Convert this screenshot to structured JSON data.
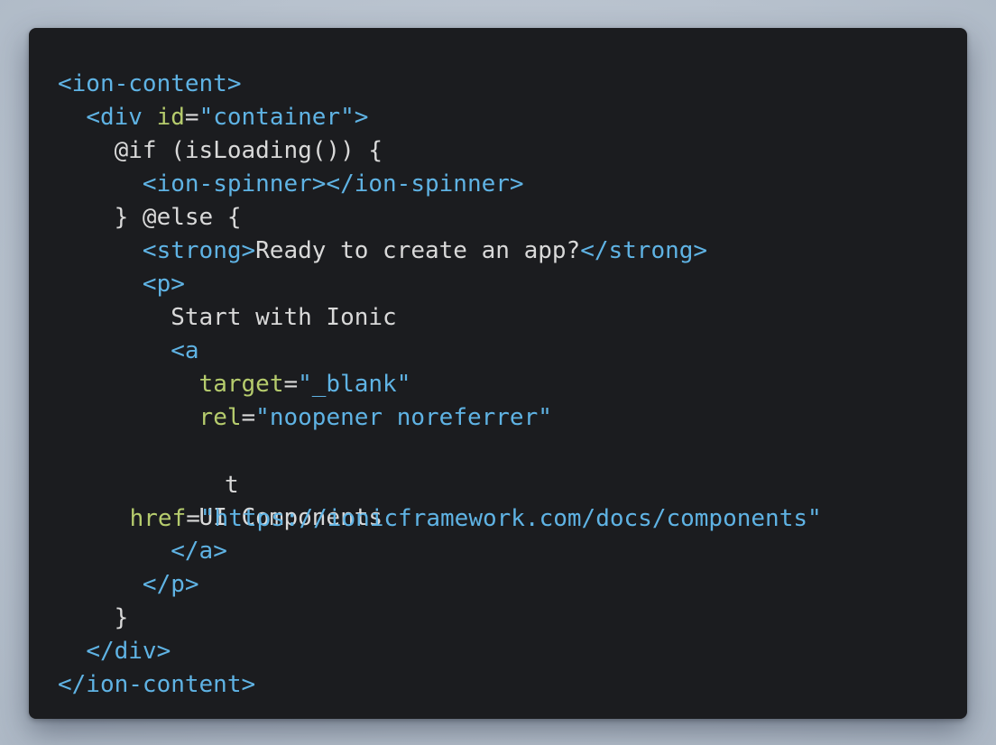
{
  "colors": {
    "background": "#b9c3cf",
    "editor_background": "#1b1c1f",
    "tag": "#5fb3e4",
    "attribute": "#b6cc6d",
    "string": "#5fb3e4",
    "text": "#d9d9d9"
  },
  "code": {
    "lines": [
      [
        {
          "t": "tag",
          "v": "<ion-content>"
        }
      ],
      [
        {
          "t": "text",
          "v": "  "
        },
        {
          "t": "tag",
          "v": "<div "
        },
        {
          "t": "attr",
          "v": "id"
        },
        {
          "t": "text",
          "v": "="
        },
        {
          "t": "str",
          "v": "\"container\""
        },
        {
          "t": "tag",
          "v": ">"
        }
      ],
      [
        {
          "t": "text",
          "v": "    @if (isLoading()) {"
        }
      ],
      [
        {
          "t": "text",
          "v": "      "
        },
        {
          "t": "tag",
          "v": "<ion-spinner></ion-spinner>"
        }
      ],
      [
        {
          "t": "text",
          "v": "    } @else {"
        }
      ],
      [
        {
          "t": "text",
          "v": "      "
        },
        {
          "t": "tag",
          "v": "<strong>"
        },
        {
          "t": "text",
          "v": "Ready to create an app?"
        },
        {
          "t": "tag",
          "v": "</strong>"
        }
      ],
      [
        {
          "t": "text",
          "v": "      "
        },
        {
          "t": "tag",
          "v": "<p>"
        }
      ],
      [
        {
          "t": "text",
          "v": "        Start with Ionic"
        }
      ],
      [
        {
          "t": "text",
          "v": "        "
        },
        {
          "t": "tag",
          "v": "<a"
        }
      ],
      [
        {
          "t": "text",
          "v": "          "
        },
        {
          "t": "attr",
          "v": "target"
        },
        {
          "t": "text",
          "v": "="
        },
        {
          "t": "str",
          "v": "\"_blank\""
        }
      ],
      [
        {
          "t": "text",
          "v": "          "
        },
        {
          "t": "attr",
          "v": "rel"
        },
        {
          "t": "text",
          "v": "="
        },
        {
          "t": "str",
          "v": "\"noopener noreferrer\""
        }
      ],
      [
        {
          "t": "text",
          "v": ""
        }
      ],
      [
        {
          "t": "text",
          "v": ""
        }
      ],
      [
        {
          "t": "text",
          "v": "          UI Components"
        }
      ],
      [
        {
          "t": "text",
          "v": "        "
        },
        {
          "t": "tag",
          "v": "</a>"
        }
      ],
      [
        {
          "t": "text",
          "v": "      "
        },
        {
          "t": "tag",
          "v": "</p>"
        }
      ],
      [
        {
          "t": "text",
          "v": "    }"
        }
      ],
      [
        {
          "t": "text",
          "v": "  "
        },
        {
          "t": "tag",
          "v": "</div>"
        }
      ],
      [
        {
          "t": "tag",
          "v": "</ion-content>"
        }
      ]
    ],
    "overlap_line": {
      "attr": "href",
      "eq": "=",
      "str": "\"https://ionicframework.com/docs/components\"",
      "overlap_glyph": "t"
    }
  }
}
